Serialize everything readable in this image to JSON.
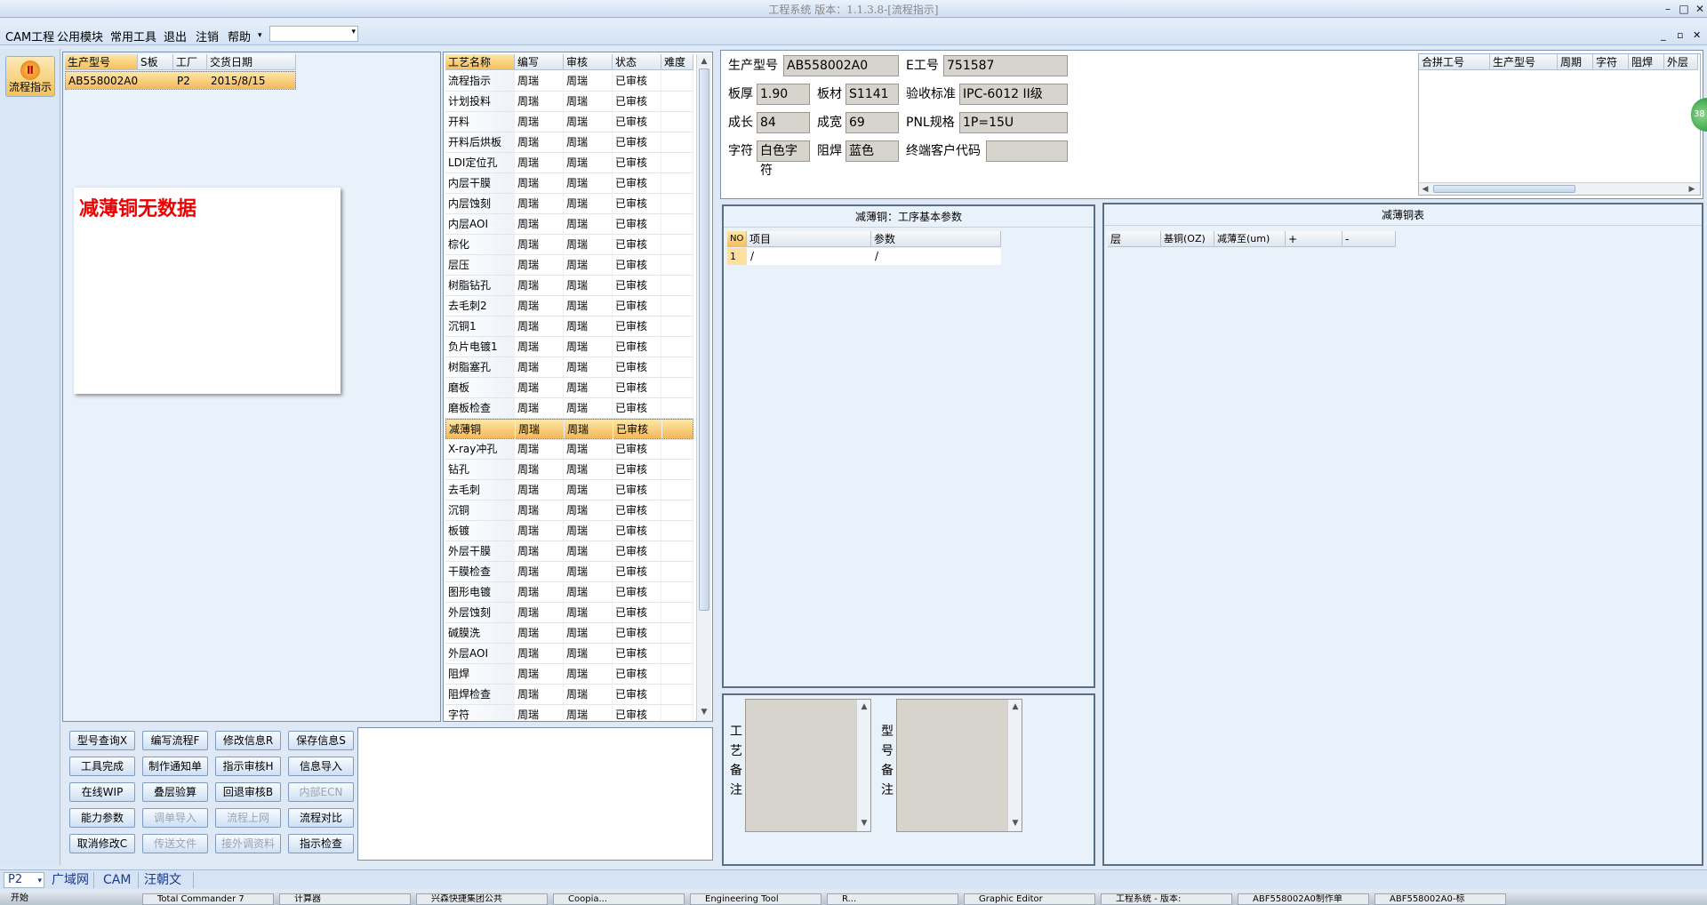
{
  "window": {
    "title": "工程系统 版本：1.1.3.8-[流程指示]"
  },
  "menu": {
    "items": [
      "CAM工程",
      "公用模块",
      "常用工具",
      "退出",
      "注销",
      "帮助"
    ],
    "dropdown_value": ""
  },
  "left_nav": {
    "flow_button": "流程指示"
  },
  "order_table": {
    "headers": [
      "生产型号",
      "S板",
      "工厂",
      "交货日期"
    ],
    "rows": [
      {
        "model": "AB558002A0",
        "s": "",
        "factory": "P2",
        "date": "2015/8/15"
      }
    ]
  },
  "no_data_message": "减薄铜无数据",
  "process_table": {
    "headers": [
      "工艺名称",
      "编写",
      "审核",
      "状态",
      "难度"
    ],
    "selected_index": 17,
    "rows": [
      {
        "name": "流程指示",
        "writer": "周瑞",
        "reviewer": "周瑞",
        "status": "已审核",
        "difficulty": ""
      },
      {
        "name": "计划投料",
        "writer": "周瑞",
        "reviewer": "周瑞",
        "status": "已审核",
        "difficulty": ""
      },
      {
        "name": "开料",
        "writer": "周瑞",
        "reviewer": "周瑞",
        "status": "已审核",
        "difficulty": ""
      },
      {
        "name": "开料后烘板",
        "writer": "周瑞",
        "reviewer": "周瑞",
        "status": "已审核",
        "difficulty": ""
      },
      {
        "name": "LDI定位孔",
        "writer": "周瑞",
        "reviewer": "周瑞",
        "status": "已审核",
        "difficulty": ""
      },
      {
        "name": "内层干膜",
        "writer": "周瑞",
        "reviewer": "周瑞",
        "status": "已审核",
        "difficulty": ""
      },
      {
        "name": "内层蚀刻",
        "writer": "周瑞",
        "reviewer": "周瑞",
        "status": "已审核",
        "difficulty": ""
      },
      {
        "name": "内层AOI",
        "writer": "周瑞",
        "reviewer": "周瑞",
        "status": "已审核",
        "difficulty": ""
      },
      {
        "name": "棕化",
        "writer": "周瑞",
        "reviewer": "周瑞",
        "status": "已审核",
        "difficulty": ""
      },
      {
        "name": "层压",
        "writer": "周瑞",
        "reviewer": "周瑞",
        "status": "已审核",
        "difficulty": ""
      },
      {
        "name": "树脂钻孔",
        "writer": "周瑞",
        "reviewer": "周瑞",
        "status": "已审核",
        "difficulty": ""
      },
      {
        "name": "去毛刺2",
        "writer": "周瑞",
        "reviewer": "周瑞",
        "status": "已审核",
        "difficulty": ""
      },
      {
        "name": "沉铜1",
        "writer": "周瑞",
        "reviewer": "周瑞",
        "status": "已审核",
        "difficulty": ""
      },
      {
        "name": "负片电镀1",
        "writer": "周瑞",
        "reviewer": "周瑞",
        "status": "已审核",
        "difficulty": ""
      },
      {
        "name": "树脂塞孔",
        "writer": "周瑞",
        "reviewer": "周瑞",
        "status": "已审核",
        "difficulty": ""
      },
      {
        "name": "磨板",
        "writer": "周瑞",
        "reviewer": "周瑞",
        "status": "已审核",
        "difficulty": ""
      },
      {
        "name": "磨板检查",
        "writer": "周瑞",
        "reviewer": "周瑞",
        "status": "已审核",
        "difficulty": ""
      },
      {
        "name": "减薄铜",
        "writer": "周瑞",
        "reviewer": "周瑞",
        "status": "已审核",
        "difficulty": ""
      },
      {
        "name": "X-ray冲孔",
        "writer": "周瑞",
        "reviewer": "周瑞",
        "status": "已审核",
        "difficulty": ""
      },
      {
        "name": "钻孔",
        "writer": "周瑞",
        "reviewer": "周瑞",
        "status": "已审核",
        "difficulty": ""
      },
      {
        "name": "去毛刺",
        "writer": "周瑞",
        "reviewer": "周瑞",
        "status": "已审核",
        "difficulty": ""
      },
      {
        "name": "沉铜",
        "writer": "周瑞",
        "reviewer": "周瑞",
        "status": "已审核",
        "difficulty": ""
      },
      {
        "name": "板镀",
        "writer": "周瑞",
        "reviewer": "周瑞",
        "status": "已审核",
        "difficulty": ""
      },
      {
        "name": "外层干膜",
        "writer": "周瑞",
        "reviewer": "周瑞",
        "status": "已审核",
        "difficulty": ""
      },
      {
        "name": "干膜检查",
        "writer": "周瑞",
        "reviewer": "周瑞",
        "status": "已审核",
        "difficulty": ""
      },
      {
        "name": "图形电镀",
        "writer": "周瑞",
        "reviewer": "周瑞",
        "status": "已审核",
        "difficulty": ""
      },
      {
        "name": "外层蚀刻",
        "writer": "周瑞",
        "reviewer": "周瑞",
        "status": "已审核",
        "difficulty": ""
      },
      {
        "name": "碱膜洗",
        "writer": "周瑞",
        "reviewer": "周瑞",
        "status": "已审核",
        "difficulty": ""
      },
      {
        "name": "外层AOI",
        "writer": "周瑞",
        "reviewer": "周瑞",
        "status": "已审核",
        "difficulty": ""
      },
      {
        "name": "阻焊",
        "writer": "周瑞",
        "reviewer": "周瑞",
        "status": "已审核",
        "difficulty": ""
      },
      {
        "name": "阻焊检查",
        "writer": "周瑞",
        "reviewer": "周瑞",
        "status": "已审核",
        "difficulty": ""
      },
      {
        "name": "字符",
        "writer": "周瑞",
        "reviewer": "周瑞",
        "status": "已审核",
        "difficulty": ""
      }
    ]
  },
  "buttons": [
    {
      "label": "型号查询X",
      "enabled": true
    },
    {
      "label": "编写流程F",
      "enabled": true
    },
    {
      "label": "修改信息R",
      "enabled": true
    },
    {
      "label": "保存信息S",
      "enabled": true
    },
    {
      "label": "工具完成",
      "enabled": true
    },
    {
      "label": "制作通知单",
      "enabled": true
    },
    {
      "label": "指示审核H",
      "enabled": true
    },
    {
      "label": "信息导入",
      "enabled": true
    },
    {
      "label": "在线WIP",
      "enabled": true
    },
    {
      "label": "叠层验算",
      "enabled": true
    },
    {
      "label": "回退审核B",
      "enabled": true
    },
    {
      "label": "内部ECN",
      "enabled": false
    },
    {
      "label": "能力参数",
      "enabled": true
    },
    {
      "label": "调单导入",
      "enabled": false
    },
    {
      "label": "流程上网",
      "enabled": false
    },
    {
      "label": "流程对比",
      "enabled": true
    },
    {
      "label": "取消修改C",
      "enabled": true
    },
    {
      "label": "传送文件",
      "enabled": false
    },
    {
      "label": "接外调资料",
      "enabled": false
    },
    {
      "label": "指示检查",
      "enabled": true
    }
  ],
  "info": {
    "model_label": "生产型号",
    "model": "AB558002A0",
    "e_label": "E工号",
    "e_no": "751587",
    "thick_label": "板厚",
    "thickness": "1.90",
    "mat_label": "板材",
    "material": "S1141",
    "std_label": "验收标准",
    "standard": "IPC-6012 II级",
    "len_label": "成长",
    "length": "84",
    "wid_label": "成宽",
    "width": "69",
    "pnl_label": "PNL规格",
    "pnl": "1P=15U",
    "char_label": "字符",
    "character": "白色字符",
    "mask_label": "阻焊",
    "mask": "蓝色",
    "cust_label": "终端客户代码",
    "customer_code": ""
  },
  "merge_table": {
    "headers": [
      "合拼工号",
      "生产型号",
      "周期",
      "字符",
      "阻焊",
      "外层"
    ]
  },
  "side_badge": "38",
  "params_panel": {
    "title": "减薄铜：工序基本参数",
    "headers": [
      "NO",
      "项目",
      "参数"
    ],
    "rows": [
      {
        "no": "1",
        "item": "/",
        "param": "/"
      }
    ]
  },
  "copper_panel": {
    "title": "减薄铜表",
    "headers": [
      "层",
      "基铜(OZ)",
      "减薄至(um)",
      "+",
      "-"
    ]
  },
  "remarks": {
    "process_label": "工艺备注",
    "model_label": "型号备注"
  },
  "statusbar": {
    "factory": "P2",
    "network": "广域网",
    "module": "CAM",
    "user": "汪朝文"
  },
  "taskbar": {
    "start": "开始",
    "items": [
      "Total Commander 7",
      "计算器",
      "兴森快捷集团公共",
      "Coopia...",
      "Engineering Tool",
      "R...",
      "Graphic Editor",
      "工程系统 - 版本:",
      "ABF558002A0制作单",
      "ABF558002A0-标"
    ]
  }
}
